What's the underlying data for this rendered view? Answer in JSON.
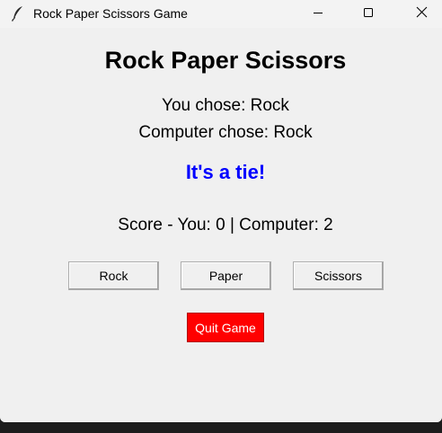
{
  "window": {
    "title": "Rock Paper Scissors Game",
    "icon": "feather-icon"
  },
  "controls": {
    "minimize": "minimize-icon",
    "maximize": "maximize-icon",
    "close": "close-icon"
  },
  "game": {
    "heading": "Rock Paper Scissors",
    "you_chose": "You chose: Rock",
    "computer_chose": "Computer chose: Rock",
    "result": "It's a tie!",
    "score": "Score - You: 0 | Computer: 2"
  },
  "buttons": {
    "rock": "Rock",
    "paper": "Paper",
    "scissors": "Scissors",
    "quit": "Quit Game"
  },
  "colors": {
    "result_text": "#0000ff",
    "quit_background": "#ff0000",
    "quit_text": "#ffffff",
    "window_background": "#f0f0f0"
  }
}
